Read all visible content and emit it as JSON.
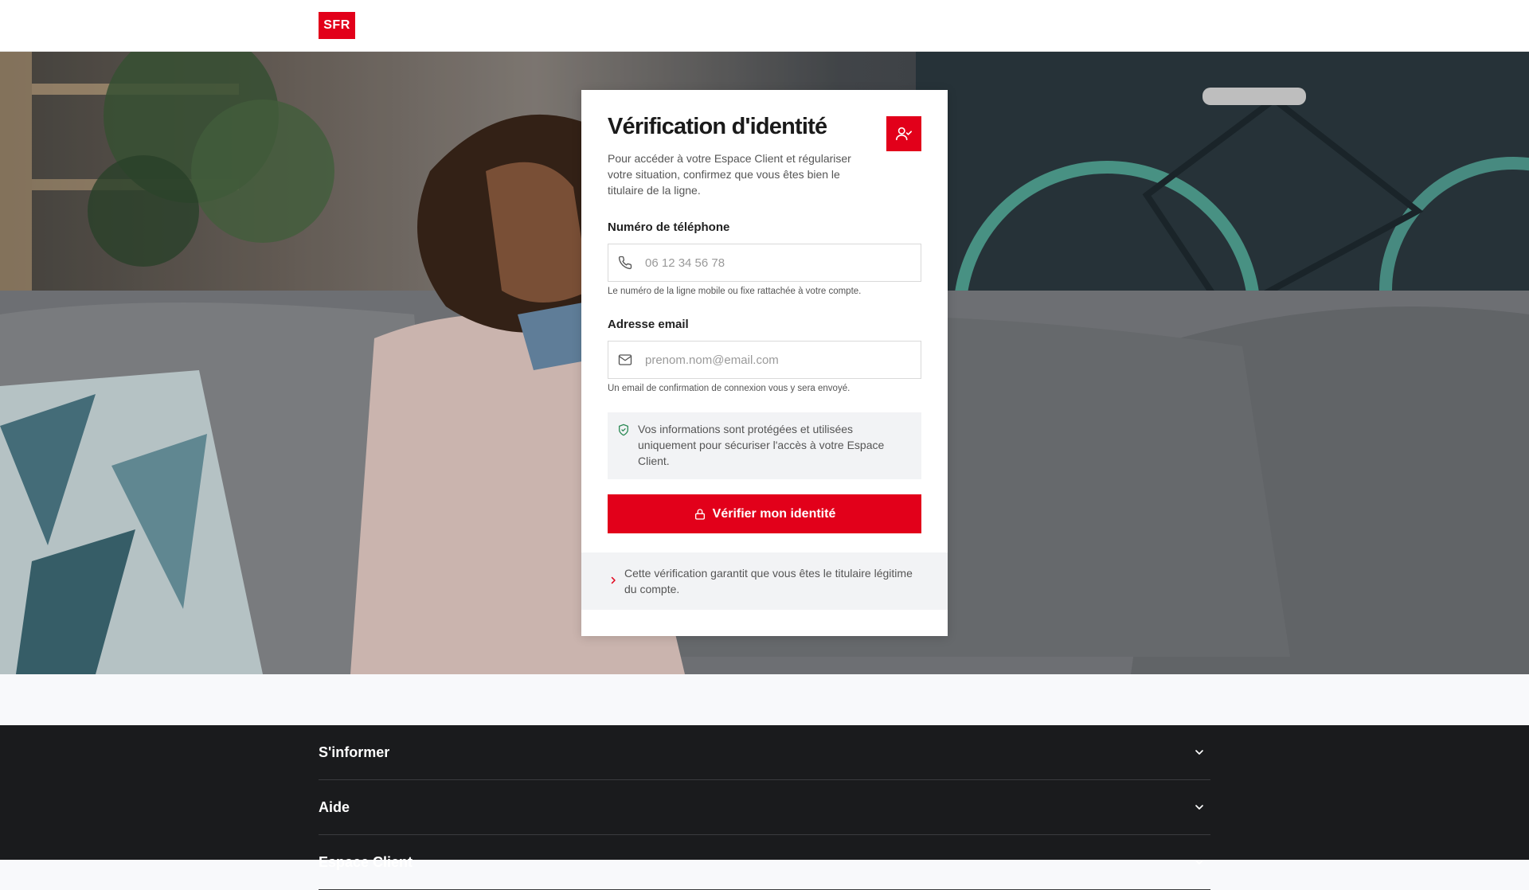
{
  "header": {
    "logo_text": "SFR",
    "brand_color": "#e2001a"
  },
  "card": {
    "title": "Vérification d'identité",
    "badge_icon": "user-check-icon",
    "intro": "Pour accéder à votre Espace Client et régulariser votre situation, confirmez que vous êtes bien le titulaire de la ligne.",
    "phone": {
      "label": "Numéro de téléphone",
      "placeholder": "06 12 34 56 78",
      "value": "",
      "icon": "phone-icon",
      "hint": "Le numéro de la ligne mobile ou fixe rattachée à votre compte."
    },
    "email": {
      "label": "Adresse email",
      "placeholder": "prenom.nom@email.com",
      "value": "",
      "icon": "mail-icon",
      "hint": "Un email de confirmation de connexion vous y sera envoyé."
    },
    "notice": {
      "icon": "shield-check-icon",
      "text": "Vos informations sont protégées et utilisées uniquement pour sécuriser l'accès à votre Espace Client."
    },
    "submit": {
      "label": "Vérifier mon identité",
      "icon": "lock-icon"
    },
    "info": {
      "icon": "chevron-right-icon",
      "text": "Cette vérification garantit que vous êtes le titulaire légitime du compte."
    }
  },
  "footer": {
    "sections": [
      {
        "label": "S'informer"
      },
      {
        "label": "Aide"
      },
      {
        "label": "Espace Client"
      }
    ]
  }
}
